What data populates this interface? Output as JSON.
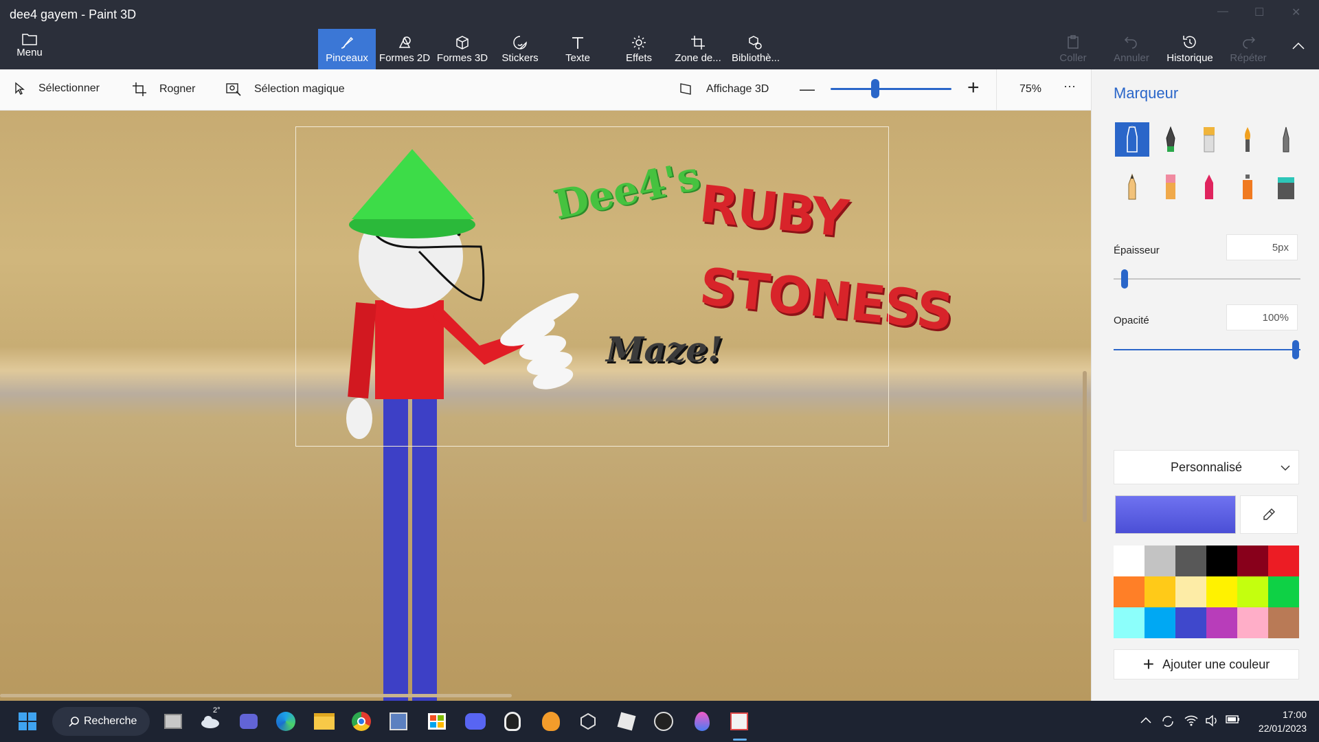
{
  "window": {
    "title": "dee4 gayem - Paint 3D"
  },
  "menu": {
    "label": "Menu"
  },
  "tools": [
    {
      "label": "Pinceaux",
      "icon": "brush-icon"
    },
    {
      "label": "Formes 2D",
      "icon": "shapes-2d-icon"
    },
    {
      "label": "Formes 3D",
      "icon": "cube-icon"
    },
    {
      "label": "Stickers",
      "icon": "sticker-icon"
    },
    {
      "label": "Texte",
      "icon": "text-icon"
    },
    {
      "label": "Effets",
      "icon": "sun-icon"
    },
    {
      "label": "Zone de...",
      "icon": "crop-icon"
    },
    {
      "label": "Bibliothè...",
      "icon": "library-icon"
    }
  ],
  "right_tools": {
    "paste": "Coller",
    "undo": "Annuler",
    "history": "Historique",
    "redo": "Répéter"
  },
  "subbar": {
    "select": "Sélectionner",
    "crop": "Rogner",
    "magic_select": "Sélection magique",
    "view3d": "Affichage 3D",
    "zoom": "75%",
    "more": "···"
  },
  "panel": {
    "title": "Marqueur",
    "thickness_label": "Épaisseur",
    "thickness_value": "5px",
    "thickness_level": 0.05,
    "opacity_label": "Opacité",
    "opacity_value": "100%",
    "opacity_level": 1.0,
    "preset": "Personnalisé",
    "current_color": "#4b4fd6",
    "add_color": "Ajouter une couleur",
    "palette": [
      "#ffffff",
      "#c3c3c3",
      "#585858",
      "#000000",
      "#88001b",
      "#ec1c24",
      "#ff7f27",
      "#ffca18",
      "#fdeca6",
      "#fff200",
      "#c4ff0e",
      "#0ed145",
      "#8cfffb",
      "#00a8f3",
      "#3f48cc",
      "#b83dba",
      "#ffaec8",
      "#b97a56"
    ]
  },
  "canvas": {
    "text_dee4": "Dee4's",
    "text_ruby": "RUBY",
    "text_stoness": "STONESS",
    "text_maze": "Maze!"
  },
  "taskbar": {
    "search": "Recherche",
    "weather_temp": "2°",
    "time": "17:00",
    "date": "22/01/2023"
  }
}
